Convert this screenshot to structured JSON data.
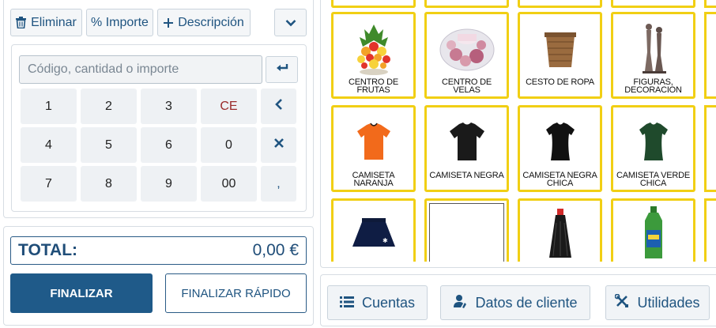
{
  "toolbar": {
    "delete_label": "Eliminar",
    "amount_label": "% Importe",
    "description_label": "Descripción"
  },
  "input": {
    "placeholder": "Código, cantidad o importe",
    "value": ""
  },
  "keypad": {
    "keys": [
      "1",
      "2",
      "3",
      "CE",
      "4",
      "5",
      "6",
      "0",
      "7",
      "8",
      "9",
      "00"
    ],
    "comma": ","
  },
  "total": {
    "label": "TOTAL:",
    "value": "0,00 €"
  },
  "actions": {
    "finalize": "FINALIZAR",
    "finalize_fast": "FINALIZAR RÁPIDO"
  },
  "products": {
    "row1": [
      {
        "label": "CENTRO DE FRUTAS",
        "icon": "fruit-basket"
      },
      {
        "label": "CENTRO DE VELAS",
        "icon": "candle-bowl"
      },
      {
        "label": "CESTO DE ROPA",
        "icon": "laundry-basket"
      },
      {
        "label": "FIGURAS, DECORACION",
        "icon": "figurines"
      }
    ],
    "row2": [
      {
        "label": "CAMISETA NARANJA",
        "icon": "tshirt-orange"
      },
      {
        "label": "CAMISETA NEGRA",
        "icon": "tshirt-black"
      },
      {
        "label": "CAMISETA NEGRA CHICA",
        "icon": "tshirt-black-women"
      },
      {
        "label": "CAMISETA VERDE CHICA",
        "icon": "tshirt-green-women"
      }
    ],
    "row3": [
      {
        "label": "",
        "icon": "skirt-navy"
      },
      {
        "label": "",
        "icon": "empty-frame"
      },
      {
        "label": "",
        "icon": "mop"
      },
      {
        "label": "",
        "icon": "detergent-bottle"
      }
    ]
  },
  "bottom": {
    "accounts": "Cuentas",
    "customer_data": "Datos de cliente",
    "utilities": "Utilidades"
  },
  "colors": {
    "primary": "#1f5a89",
    "tile_border": "#f1cf14",
    "ce_text": "#9a2b2b"
  }
}
